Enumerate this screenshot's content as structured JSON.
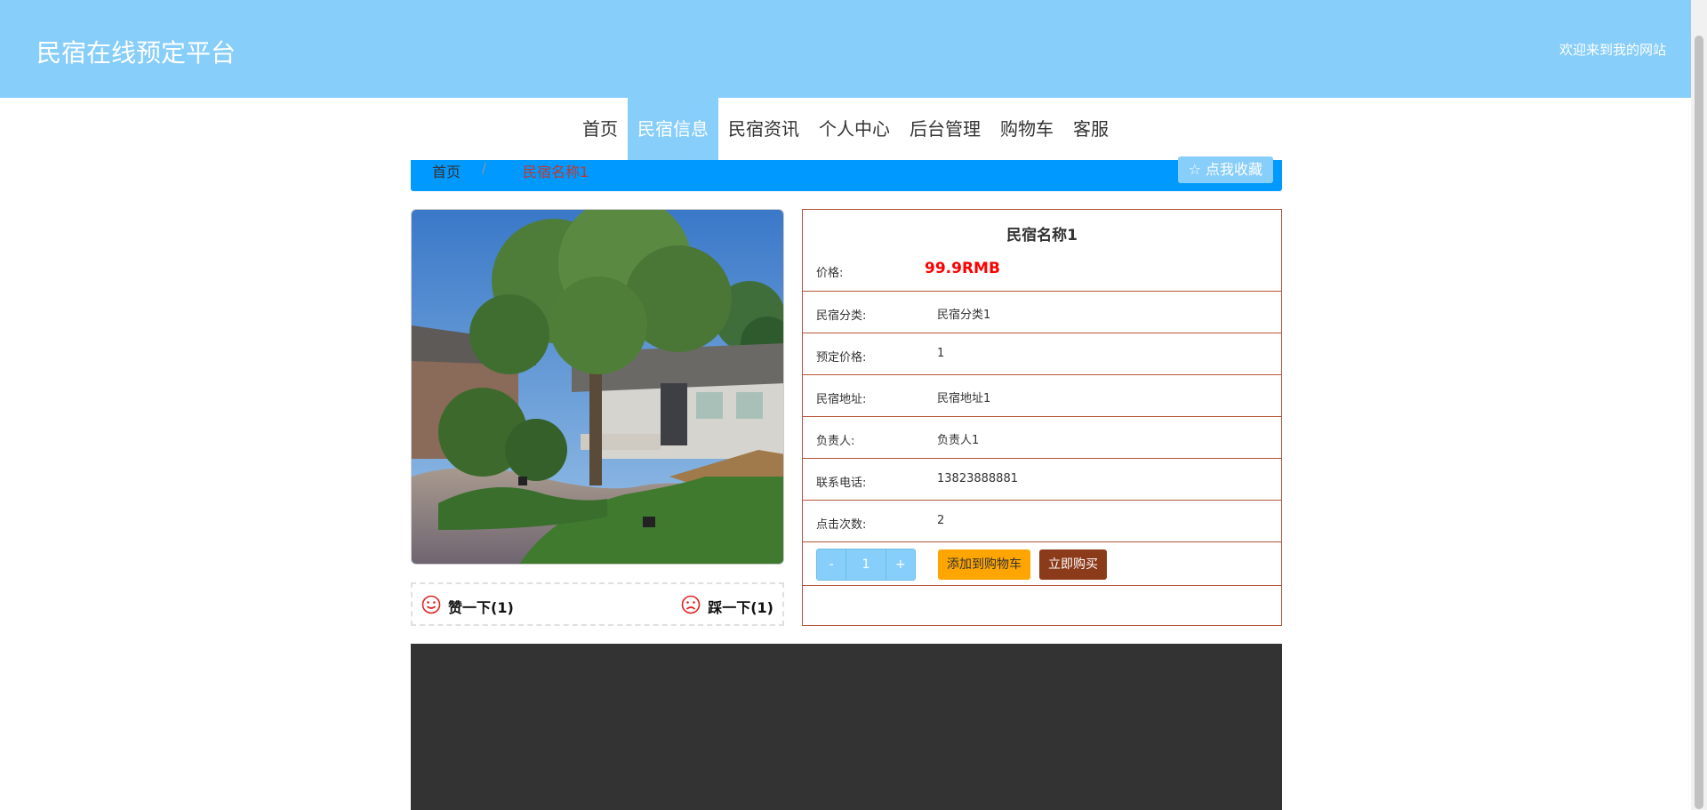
{
  "header": {
    "site_title": "民宿在线预定平台",
    "welcome": "欢迎来到我的网站"
  },
  "nav": {
    "items": [
      {
        "label": "首页"
      },
      {
        "label": "民宿信息",
        "active": true
      },
      {
        "label": "民宿资讯"
      },
      {
        "label": "个人中心"
      },
      {
        "label": "后台管理"
      },
      {
        "label": "购物车"
      },
      {
        "label": "客服"
      }
    ]
  },
  "breadcrumb": {
    "home": "首页",
    "separator": "/",
    "current": "民宿名称1",
    "favorite_label": "☆ 点我收藏"
  },
  "product": {
    "name": "民宿名称1",
    "price_label": "价格:",
    "price_value": "99.9RMB",
    "rows": [
      {
        "label": "民宿分类:",
        "value": "民宿分类1"
      },
      {
        "label": "预定价格:",
        "value": "1"
      },
      {
        "label": "民宿地址:",
        "value": "民宿地址1"
      },
      {
        "label": "负责人:",
        "value": "负责人1"
      },
      {
        "label": "联系电话:",
        "value": "13823888881"
      },
      {
        "label": "点击次数:",
        "value": "2"
      }
    ],
    "quantity": {
      "minus": "-",
      "value": "1",
      "plus": "+"
    },
    "add_to_cart": "添加到购物车",
    "buy_now": "立即购买"
  },
  "votes": {
    "like": "赞一下(1)",
    "dislike": "踩一下(1)"
  },
  "colors": {
    "header_bg": "#87CEFA",
    "breadcrumb_bg": "#0099FF",
    "price": "#ff0000",
    "border": "#b5553a",
    "cart_button": "#FFA500",
    "buy_button": "#8B3A1A",
    "footer_bg": "#333333"
  }
}
